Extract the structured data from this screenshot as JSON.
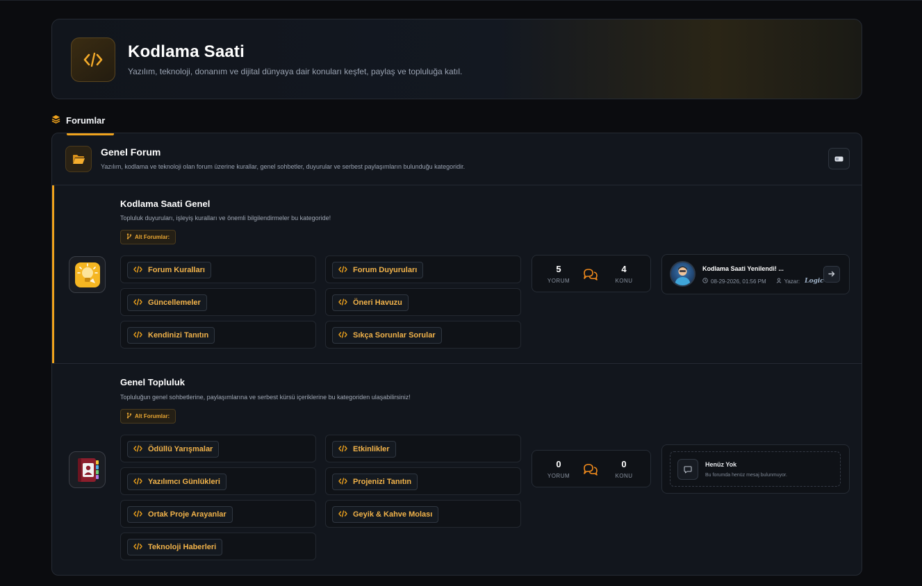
{
  "header": {
    "title": "Kodlama Saati",
    "subtitle": "Yazılım, teknoloji, donanım ve dijital dünyaya dair konuları keşfet, paylaş ve topluluğa katıl."
  },
  "section": {
    "label": "Forumlar"
  },
  "category": {
    "title": "Genel Forum",
    "description": "Yazılım, kodlama ve teknoloji olan forum üzerine kurallar, genel sohbetler, duyurular ve serbest paylaşımların bulunduğu kategoridir."
  },
  "forums": [
    {
      "title": "Kodlama Saati Genel",
      "description": "Topluluk duyuruları, işleyiş kuralları ve önemli bilgilendirmeler bu kategoride!",
      "subforums_label": "Alt Forumlar:",
      "subforums": [
        "Forum Kuralları",
        "Forum Duyuruları",
        "Güncellemeler",
        "Öneri Havuzu",
        "Kendinizi Tanıtın",
        "Sıkça Sorunlar Sorular"
      ],
      "stats": {
        "posts": "5",
        "posts_label": "YORUM",
        "topics": "4",
        "topics_label": "KONU"
      },
      "last_post": {
        "title": "Kodlama Saati Yenilendi! ...",
        "date": "08-29-2026, 01:56 PM",
        "author_label": "Yazar:",
        "author": "Logic"
      }
    },
    {
      "title": "Genel Topluluk",
      "description": "Topluluğun genel sohbetlerine, paylaşımlarına ve serbest kürsü içeriklerine bu kategoriden ulaşabilirsiniz!",
      "subforums_label": "Alt Forumlar:",
      "subforums": [
        "Ödüllü Yarışmalar",
        "Etkinlikler",
        "Yazılımcı Günlükleri",
        "Projenizi Tanıtın",
        "Ortak Proje Arayanlar",
        "Geyik & Kahve Molası",
        "Teknoloji Haberleri"
      ],
      "stats": {
        "posts": "0",
        "posts_label": "YORUM",
        "topics": "0",
        "topics_label": "KONU"
      },
      "empty": {
        "title": "Henüz Yok",
        "subtitle": "Bu forumda henüz mesaj bulunmuyor."
      }
    }
  ],
  "colors": {
    "accent": "#f0a31c",
    "background": "#0b0c0f",
    "panel": "#12161d"
  },
  "icons": {
    "header": "code-icon",
    "section": "layers-icon",
    "category": "folder-icon",
    "toggle": "toggle-icon",
    "forum1": "lightbulb-icon",
    "forum2": "contacts-book-icon"
  }
}
